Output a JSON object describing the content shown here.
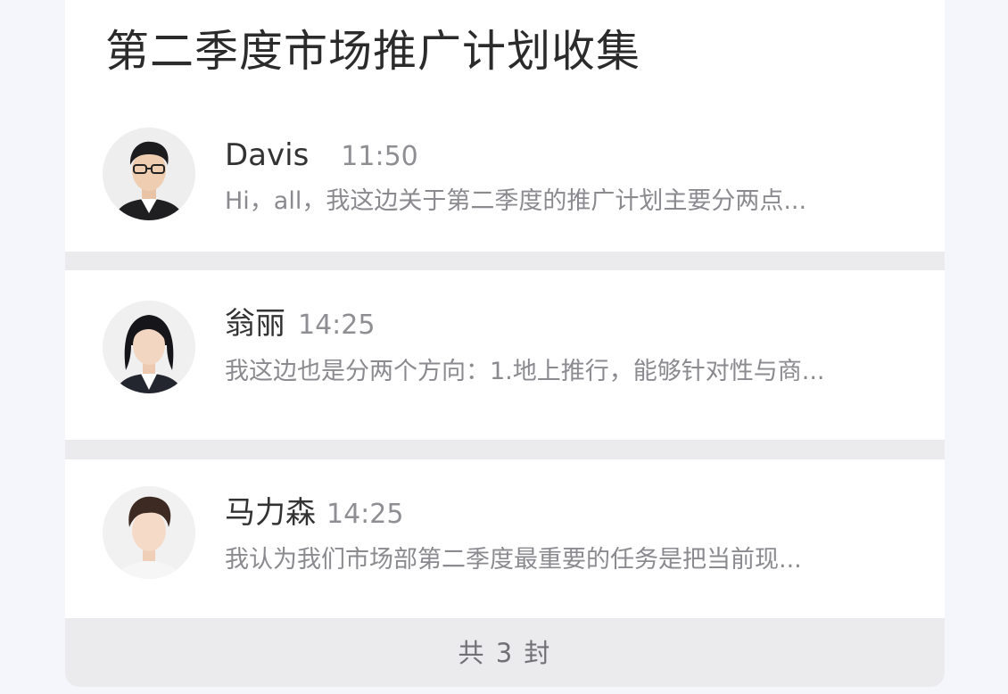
{
  "thread": {
    "title": "第二季度市场推广计划收集",
    "messages": [
      {
        "sender": "Davis",
        "time": "11:50",
        "preview": "Hi，all，我这边关于第二季度的推广计划主要分两点..."
      },
      {
        "sender": "翁丽",
        "time": "14:25",
        "preview": "我这边也是分两个方向：1.地上推行，能够针对性与商..."
      },
      {
        "sender": "马力森",
        "time": "14:25",
        "preview": "我认为我们市场部第二季度最重要的任务是把当前现..."
      }
    ],
    "footer_count": "共 3 封"
  }
}
